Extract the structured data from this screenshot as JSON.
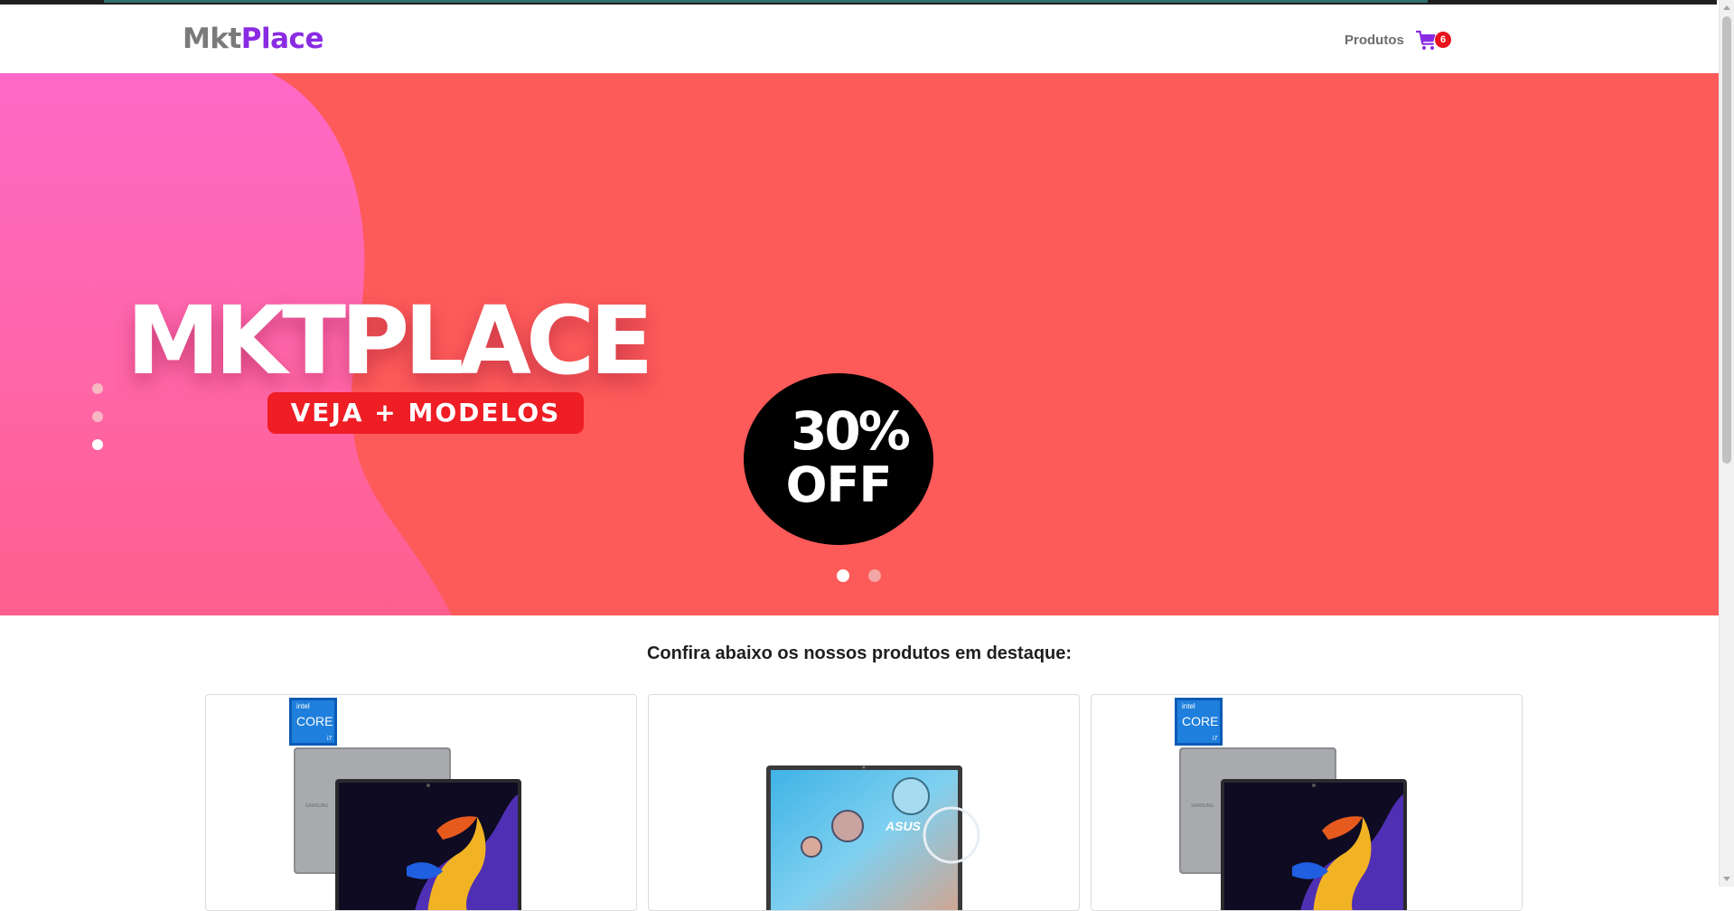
{
  "brand": {
    "part1": "Mkt",
    "part2": "Place"
  },
  "nav": {
    "products_label": "Produtos",
    "cart_count": "6"
  },
  "hero": {
    "title": "MKTPLACE",
    "button_label": "VEJA + MODELOS",
    "discount_line1": "30%",
    "discount_line2": "OFF",
    "slides": 2,
    "active_slide": 1
  },
  "featured": {
    "title": "Confira abaixo os nossos produtos em destaque:",
    "products": [
      {
        "image": "samsung-laptop-intel-core-i7",
        "badge_brand": "intel",
        "badge_text": "CORE",
        "badge_tier": "i7"
      },
      {
        "image": "asus-laptop",
        "logo_text": "ASUS"
      },
      {
        "image": "samsung-laptop-intel-core-i7",
        "badge_brand": "intel",
        "badge_text": "CORE",
        "badge_tier": "i7"
      }
    ]
  },
  "colors": {
    "accent": "#8a2be2",
    "hero_bg": "#fd5a5a",
    "hero_blob": "#ff62c0",
    "button": "#ef1d24",
    "badge": "#e8131d"
  }
}
